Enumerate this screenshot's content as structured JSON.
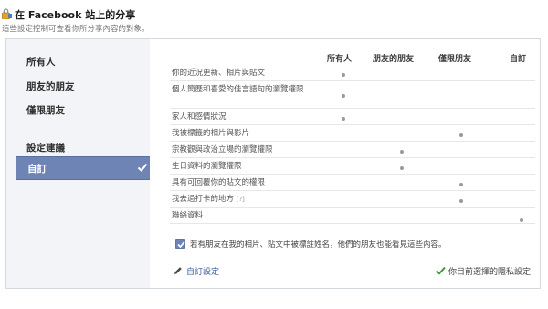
{
  "header": {
    "title": "在 Facebook 站上的分享",
    "subtitle": "這些設定控制可查看你所分享內容的對象。",
    "icon": "lock-icon"
  },
  "sidebar": {
    "items": [
      {
        "label": "所有人",
        "selected": false
      },
      {
        "label": "朋友的朋友",
        "selected": false
      },
      {
        "label": "僅限朋友",
        "selected": false
      },
      {
        "label": "設定建議",
        "selected": false
      },
      {
        "label": "自訂",
        "selected": true
      }
    ],
    "active_color": "#6d84b4"
  },
  "table": {
    "columns": [
      "所有人",
      "朋友的朋友",
      "僅限朋友",
      "自訂"
    ],
    "rows": [
      {
        "label": "你的近況更新、相片與貼文",
        "setting": "所有人"
      },
      {
        "label": "個人簡歷和喜愛的佳言語句的瀏覽權限",
        "setting": "所有人"
      },
      {
        "label": "家人和感情狀況",
        "setting": "所有人"
      },
      {
        "label": "我被標籤的相片與影片",
        "setting": "僅限朋友"
      },
      {
        "label": "宗教觀與政治立場的瀏覽權限",
        "setting": "朋友的朋友"
      },
      {
        "label": "生日資料的瀏覽權限",
        "setting": "朋友的朋友"
      },
      {
        "label": "具有可回覆你的貼文的權限",
        "setting": "僅限朋友"
      },
      {
        "label": "我去過打卡的地方",
        "help": "[?]",
        "setting": "僅限朋友"
      },
      {
        "label": "聯絡資料",
        "setting": "自訂"
      }
    ]
  },
  "checkbox": {
    "checked": true,
    "label": "若有朋友在我的相片、貼文中被標註姓名，他們的朋友也能看見這些內容。"
  },
  "footer": {
    "edit_label": "自訂設定",
    "current_label": "你目前選擇的隱私設定",
    "link_color": "#3b5998",
    "check_color": "#3c9e2e"
  }
}
